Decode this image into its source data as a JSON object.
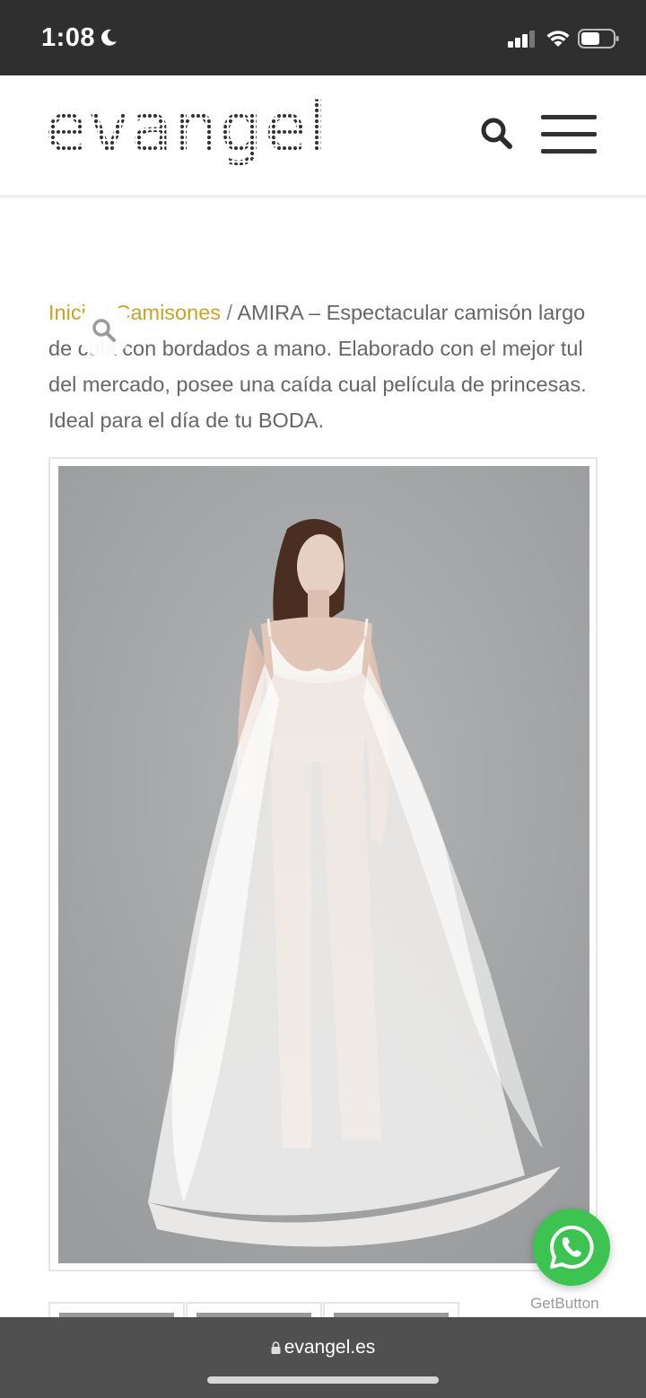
{
  "status_bar": {
    "time": "1:08"
  },
  "header": {
    "logo_text": "evangel"
  },
  "breadcrumb": {
    "home": "Inicio",
    "separator": " / ",
    "category": "Camisones",
    "current": "AMIRA – Espectacular camisón largo de cola con bordados a mano. Elaborado con el mejor tul del mercado, posee una caída cual película de princesas. Ideal para el día de tu BODA."
  },
  "product": {
    "image_alt": "Model wearing white tulle nightgown"
  },
  "whatsapp": {
    "label": "GetButton"
  },
  "browser": {
    "url": "evangel.es"
  },
  "colors": {
    "accent": "#c9a227",
    "whatsapp": "#3dc34f",
    "status_bar": "#2f2f2f",
    "browser_bar": "#505050"
  }
}
